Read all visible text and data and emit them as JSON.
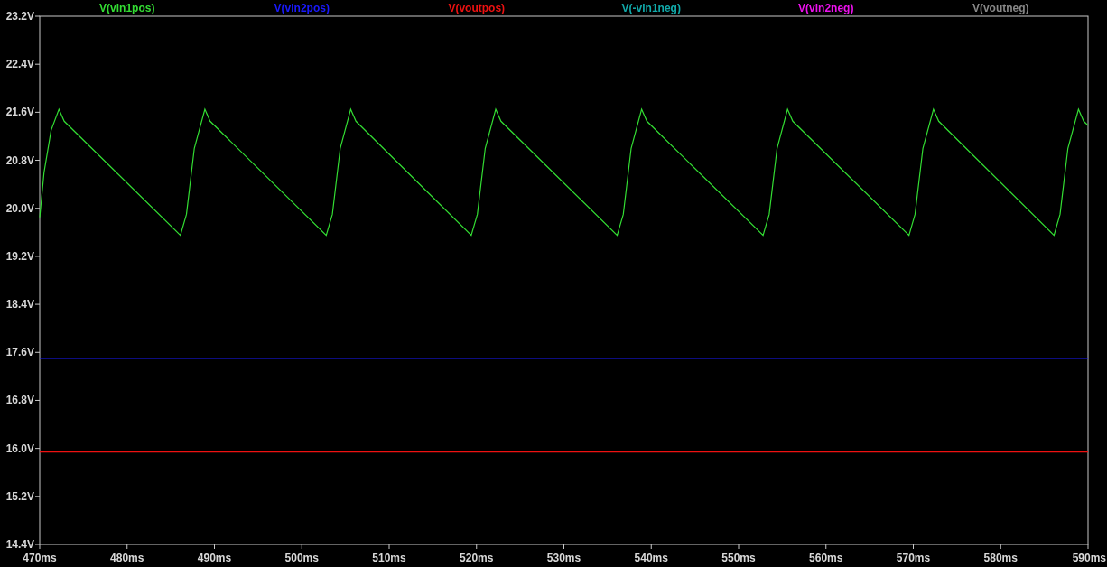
{
  "plot": {
    "chart_data": {
      "type": "line",
      "x": [
        470,
        470.5,
        471.3,
        472.2,
        472.8,
        486.1,
        486.8,
        487.7,
        488.9,
        489.5,
        502.8,
        503.5,
        504.4,
        505.6,
        506.2,
        519.4,
        520.1,
        521.0,
        522.2,
        522.8,
        536.1,
        536.8,
        537.7,
        538.9,
        539.5,
        552.8,
        553.5,
        554.4,
        555.6,
        556.2,
        569.5,
        570.2,
        571.1,
        572.3,
        572.9,
        586.1,
        586.8,
        587.7,
        588.9,
        589.5,
        590
      ],
      "series": [
        {
          "name": "V(vin1pos)",
          "color": "#33dd33",
          "values": [
            19.85,
            20.6,
            21.3,
            21.65,
            21.45,
            19.55,
            19.9,
            21.0,
            21.65,
            21.45,
            19.55,
            19.9,
            21.0,
            21.65,
            21.45,
            19.55,
            19.9,
            21.0,
            21.65,
            21.45,
            19.55,
            19.9,
            21.0,
            21.65,
            21.45,
            19.55,
            19.9,
            21.0,
            21.65,
            21.45,
            19.55,
            19.9,
            21.0,
            21.65,
            21.45,
            19.55,
            19.9,
            21.0,
            21.65,
            21.45,
            21.38
          ]
        },
        {
          "name": "V(vin2pos)",
          "color": "#1a1aff",
          "values": [
            17.5,
            17.5,
            17.5,
            17.5,
            17.5,
            17.5,
            17.5,
            17.5,
            17.5,
            17.5,
            17.5,
            17.5,
            17.5,
            17.5,
            17.5,
            17.5,
            17.5,
            17.5,
            17.5,
            17.5,
            17.5,
            17.5,
            17.5,
            17.5,
            17.5,
            17.5,
            17.5,
            17.5,
            17.5,
            17.5,
            17.5,
            17.5,
            17.5,
            17.5,
            17.5,
            17.5,
            17.5,
            17.5,
            17.5,
            17.5,
            17.5
          ]
        },
        {
          "name": "V(voutpos)",
          "color": "#ee1111",
          "values": [
            15.94,
            15.94,
            15.94,
            15.94,
            15.94,
            15.94,
            15.94,
            15.94,
            15.94,
            15.94,
            15.94,
            15.94,
            15.94,
            15.94,
            15.94,
            15.94,
            15.94,
            15.94,
            15.94,
            15.94,
            15.94,
            15.94,
            15.94,
            15.94,
            15.94,
            15.94,
            15.94,
            15.94,
            15.94,
            15.94,
            15.94,
            15.94,
            15.94,
            15.94,
            15.94,
            15.94,
            15.94,
            15.94,
            15.94,
            15.94,
            15.94
          ]
        },
        {
          "name": "V(-vin1neg)",
          "color": "#11aaaa",
          "values": [
            null,
            null,
            null,
            null,
            null,
            null,
            null,
            null,
            null,
            null,
            null,
            null,
            null,
            null,
            null,
            null,
            null,
            null,
            null,
            null,
            null,
            null,
            null,
            null,
            null,
            null,
            null,
            null,
            null,
            null,
            null,
            null,
            null,
            null,
            null,
            null,
            null,
            null,
            null,
            null,
            null
          ]
        },
        {
          "name": "V(vin2neg)",
          "color": "#ee11ee",
          "values": [
            null,
            null,
            null,
            null,
            null,
            null,
            null,
            null,
            null,
            null,
            null,
            null,
            null,
            null,
            null,
            null,
            null,
            null,
            null,
            null,
            null,
            null,
            null,
            null,
            null,
            null,
            null,
            null,
            null,
            null,
            null,
            null,
            null,
            null,
            null,
            null,
            null,
            null,
            null,
            null,
            null
          ]
        },
        {
          "name": "V(voutneg)",
          "color": "#888888",
          "values": [
            null,
            null,
            null,
            null,
            null,
            null,
            null,
            null,
            null,
            null,
            null,
            null,
            null,
            null,
            null,
            null,
            null,
            null,
            null,
            null,
            null,
            null,
            null,
            null,
            null,
            null,
            null,
            null,
            null,
            null,
            null,
            null,
            null,
            null,
            null,
            null,
            null,
            null,
            null,
            null,
            null
          ]
        }
      ],
      "xlim": [
        470,
        590
      ],
      "ylim": [
        14.4,
        23.2
      ],
      "xticks": [
        {
          "value": 470,
          "label": "470ms"
        },
        {
          "value": 480,
          "label": "480ms"
        },
        {
          "value": 490,
          "label": "490ms"
        },
        {
          "value": 500,
          "label": "500ms"
        },
        {
          "value": 510,
          "label": "510ms"
        },
        {
          "value": 520,
          "label": "520ms"
        },
        {
          "value": 530,
          "label": "530ms"
        },
        {
          "value": 540,
          "label": "540ms"
        },
        {
          "value": 550,
          "label": "550ms"
        },
        {
          "value": 560,
          "label": "560ms"
        },
        {
          "value": 570,
          "label": "570ms"
        },
        {
          "value": 580,
          "label": "580ms"
        },
        {
          "value": 590,
          "label": "590ms"
        }
      ],
      "yticks": [
        {
          "value": 23.2,
          "label": "23.2V"
        },
        {
          "value": 22.4,
          "label": "22.4V"
        },
        {
          "value": 21.6,
          "label": "21.6V"
        },
        {
          "value": 20.8,
          "label": "20.8V"
        },
        {
          "value": 20.0,
          "label": "20.0V"
        },
        {
          "value": 19.2,
          "label": "19.2V"
        },
        {
          "value": 18.4,
          "label": "18.4V"
        },
        {
          "value": 17.6,
          "label": "17.6V"
        },
        {
          "value": 16.8,
          "label": "16.8V"
        },
        {
          "value": 16.0,
          "label": "16.0V"
        },
        {
          "value": 15.2,
          "label": "15.2V"
        },
        {
          "value": 14.4,
          "label": "14.4V"
        }
      ]
    }
  }
}
